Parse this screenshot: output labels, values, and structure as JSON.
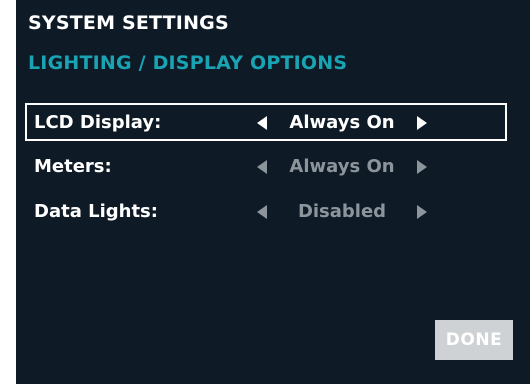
{
  "header": {
    "title": "SYSTEM SETTINGS",
    "subtitle": "LIGHTING / DISPLAY OPTIONS"
  },
  "settings": [
    {
      "label": "LCD Display:",
      "value": "Always On",
      "selected": true,
      "enabled": true
    },
    {
      "label": "Meters:",
      "value": "Always On",
      "selected": false,
      "enabled": false
    },
    {
      "label": "Data Lights:",
      "value": "Disabled",
      "selected": false,
      "enabled": false
    }
  ],
  "footer": {
    "done_label": "DONE",
    "done_enabled": false
  },
  "colors": {
    "background": "#0e1a26",
    "accent": "#1aa3b3",
    "text": "#ffffff",
    "dim_text": "#8d959c",
    "disabled_button": "#cfd2d4"
  },
  "icons": {
    "decrement": "left-arrow-icon",
    "increment": "right-arrow-icon"
  }
}
